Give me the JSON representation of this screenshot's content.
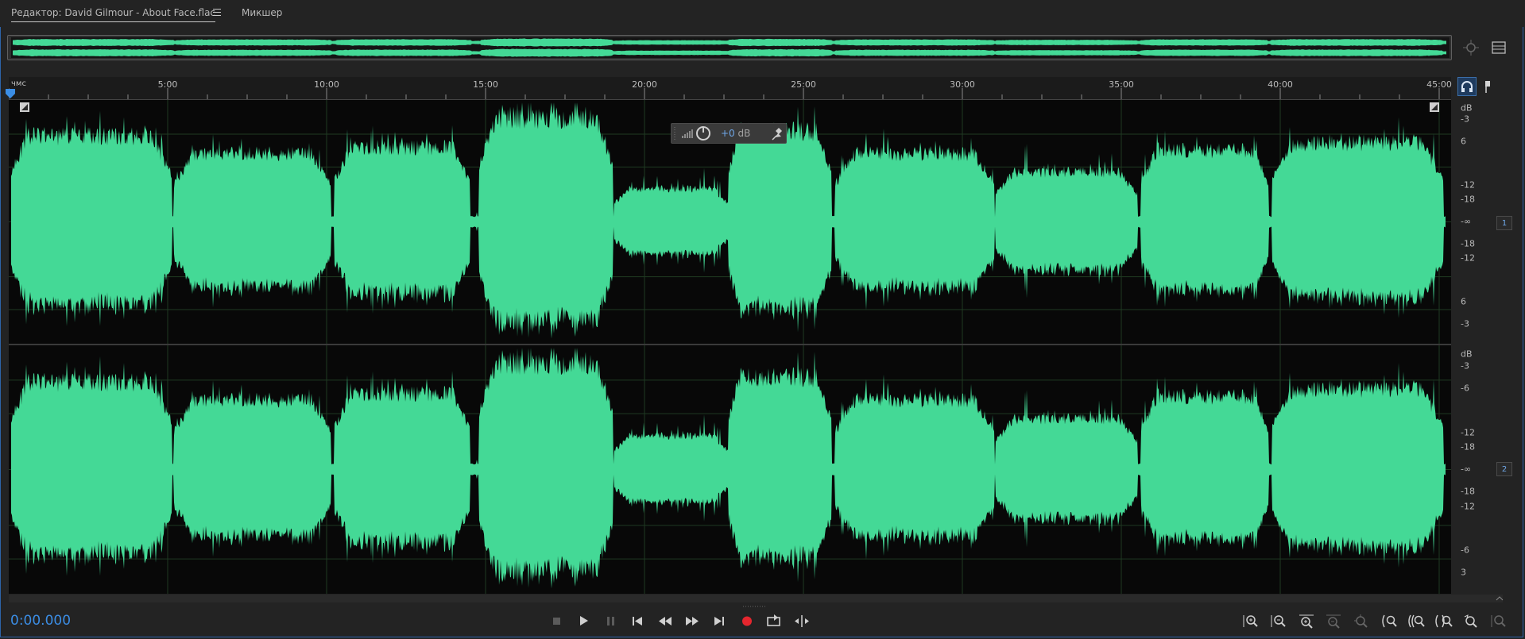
{
  "tabs": {
    "editor_label": "Редактор: David Gilmour - About Face.flac",
    "mixer_label": "Микшер"
  },
  "ruler": {
    "unit": "чмс",
    "labels": [
      "5:00",
      "10:00",
      "15:00",
      "20:00",
      "25:00",
      "30:00",
      "35:00",
      "40:00",
      "45:00"
    ]
  },
  "hud": {
    "value": "+0",
    "unit": "dB"
  },
  "db_scale": {
    "header": "dB",
    "channel1_labels": [
      "-3",
      "6",
      "-12",
      "-18",
      "-∞",
      "-18",
      "-12",
      "6",
      "-3"
    ],
    "channel2_labels": [
      "-3",
      "-6",
      "-12",
      "-18",
      "-∞",
      "-18",
      "-12",
      "-6",
      "3"
    ]
  },
  "channels": [
    "1",
    "2"
  ],
  "transport": {
    "timecode": "0:00.000"
  },
  "colors": {
    "waveform": "#44d996",
    "accent": "#3b8de4",
    "record": "#e5262e",
    "background": "#080808"
  },
  "icons": [
    "headphones-icon",
    "marker-icon",
    "stop-icon",
    "play-icon",
    "pause-icon",
    "skip-to-start-icon",
    "rewind-icon",
    "fast-forward-icon",
    "skip-to-end-icon",
    "record-icon",
    "loop-icon",
    "skip-selection-icon",
    "zoom-in-amplitude-icon",
    "zoom-out-amplitude-icon",
    "zoom-in-time-icon",
    "zoom-out-time-icon",
    "zoom-out-full-icon",
    "zoom-in-left-icon",
    "zoom-in-right-icon",
    "zoom-selection-icon",
    "zoom-reset-icon",
    "zoom-all-icon"
  ]
}
